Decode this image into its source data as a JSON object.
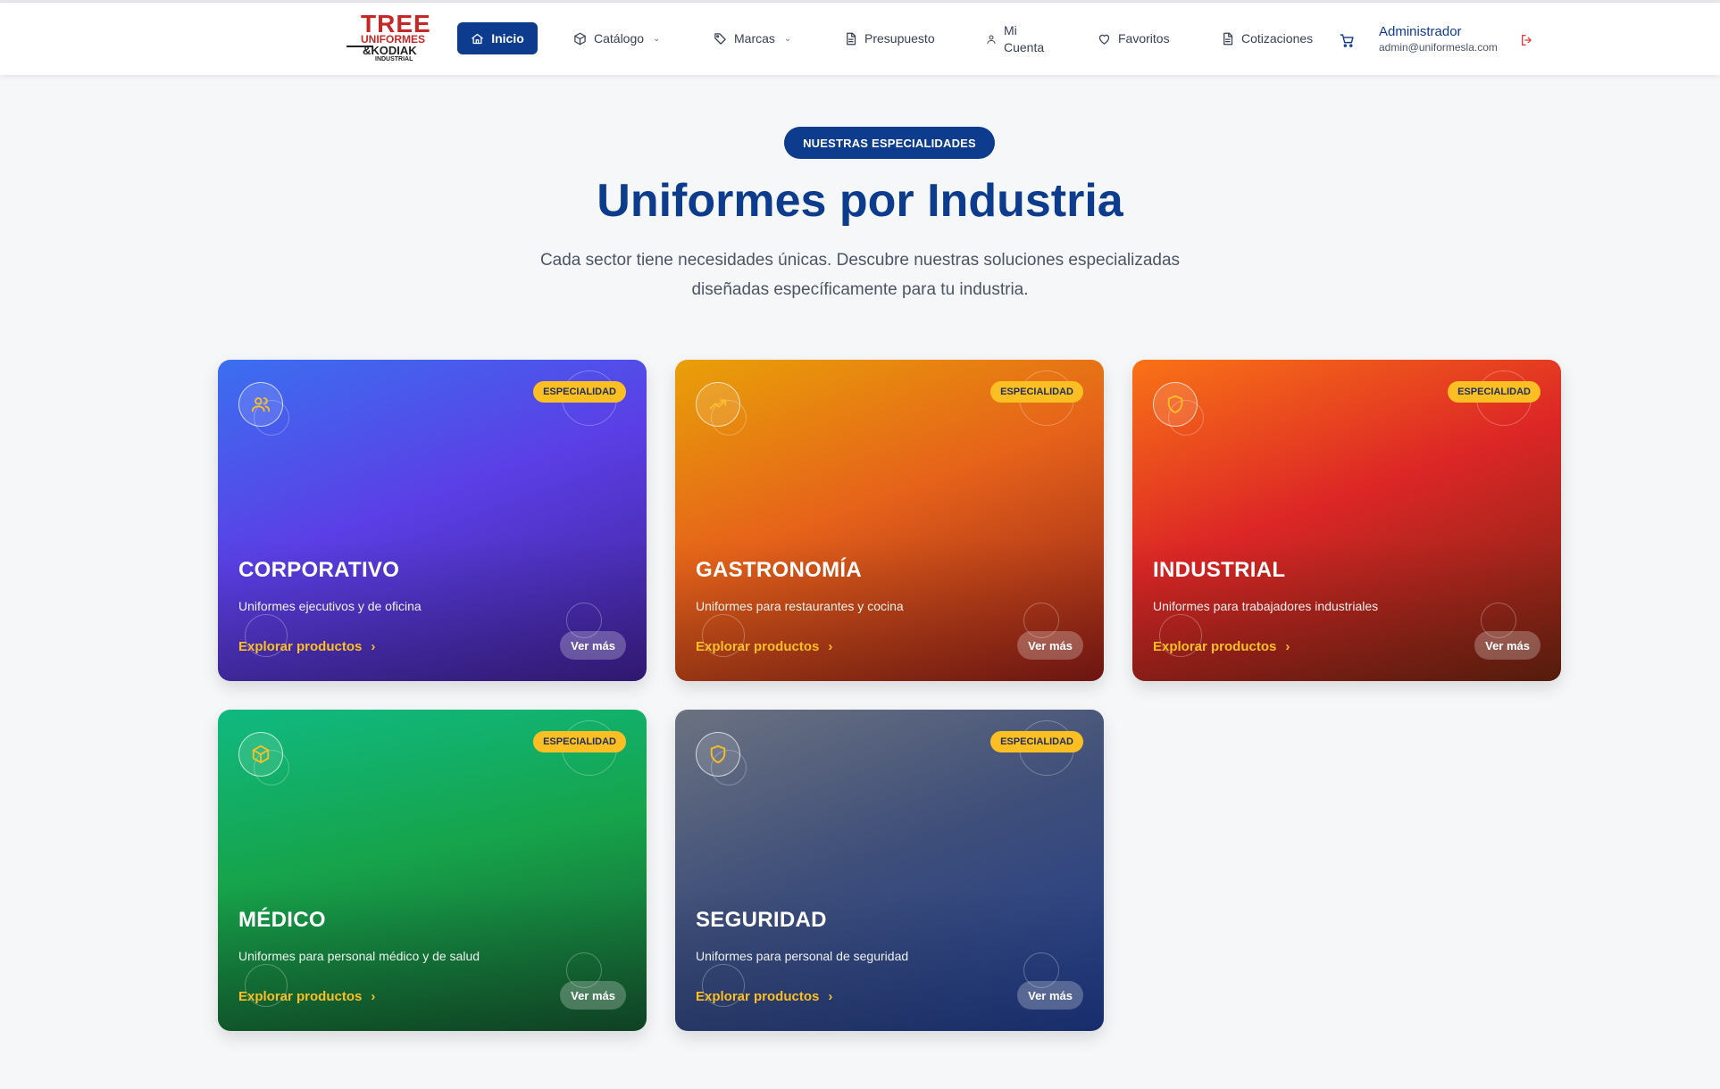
{
  "header": {
    "logo": {
      "line1": "TREE",
      "line2": "UNIFORMES",
      "line3": "&KODIAK",
      "line4": "INDUSTRIAL"
    },
    "nav": {
      "home": "Inicio",
      "catalog": "Catálogo",
      "brands": "Marcas",
      "budget": "Presupuesto",
      "account_line1": "Mi",
      "account_line2": "Cuenta",
      "favorites": "Favoritos",
      "quotes": "Cotizaciones"
    },
    "user": {
      "name": "Administrador",
      "email": "admin@uniformesla.com"
    }
  },
  "hero": {
    "pill": "NUESTRAS ESPECIALIDADES",
    "title": "Uniformes por Industria",
    "subtitle_line1": "Cada sector tiene necesidades únicas. Descubre nuestras soluciones especializadas",
    "subtitle_line2": "diseñadas específicamente para tu industria."
  },
  "cards": [
    {
      "name": "CORPORATIVO",
      "description": "Uniformes ejecutivos y de oficina",
      "badge": "ESPECIALIDAD",
      "explore": "Explorar productos",
      "more": "Ver más",
      "icon": "users-icon"
    },
    {
      "name": "GASTRONOMÍA",
      "description": "Uniformes para restaurantes y cocina",
      "badge": "ESPECIALIDAD",
      "explore": "Explorar productos",
      "more": "Ver más",
      "icon": "trending-up-icon"
    },
    {
      "name": "INDUSTRIAL",
      "description": "Uniformes para trabajadores industriales",
      "badge": "ESPECIALIDAD",
      "explore": "Explorar productos",
      "more": "Ver más",
      "icon": "shield-icon"
    },
    {
      "name": "MÉDICO",
      "description": "Uniformes para personal médico y de salud",
      "badge": "ESPECIALIDAD",
      "explore": "Explorar productos",
      "more": "Ver más",
      "icon": "box-icon"
    },
    {
      "name": "SEGURIDAD",
      "description": "Uniformes para personal de seguridad",
      "badge": "ESPECIALIDAD",
      "explore": "Explorar productos",
      "more": "Ver más",
      "icon": "shield-icon"
    }
  ],
  "colors": {
    "primary": "#0d3b8e",
    "accent": "#fbbf24",
    "logout": "#e53935"
  }
}
